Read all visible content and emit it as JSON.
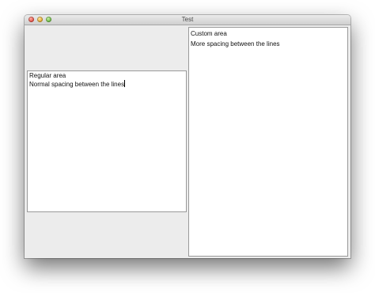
{
  "window": {
    "title": "Test"
  },
  "left_area": {
    "lines": [
      "Regular area",
      "Normal spacing between the lines"
    ]
  },
  "right_area": {
    "lines": [
      "Custom area",
      "More spacing between the lines"
    ]
  }
}
